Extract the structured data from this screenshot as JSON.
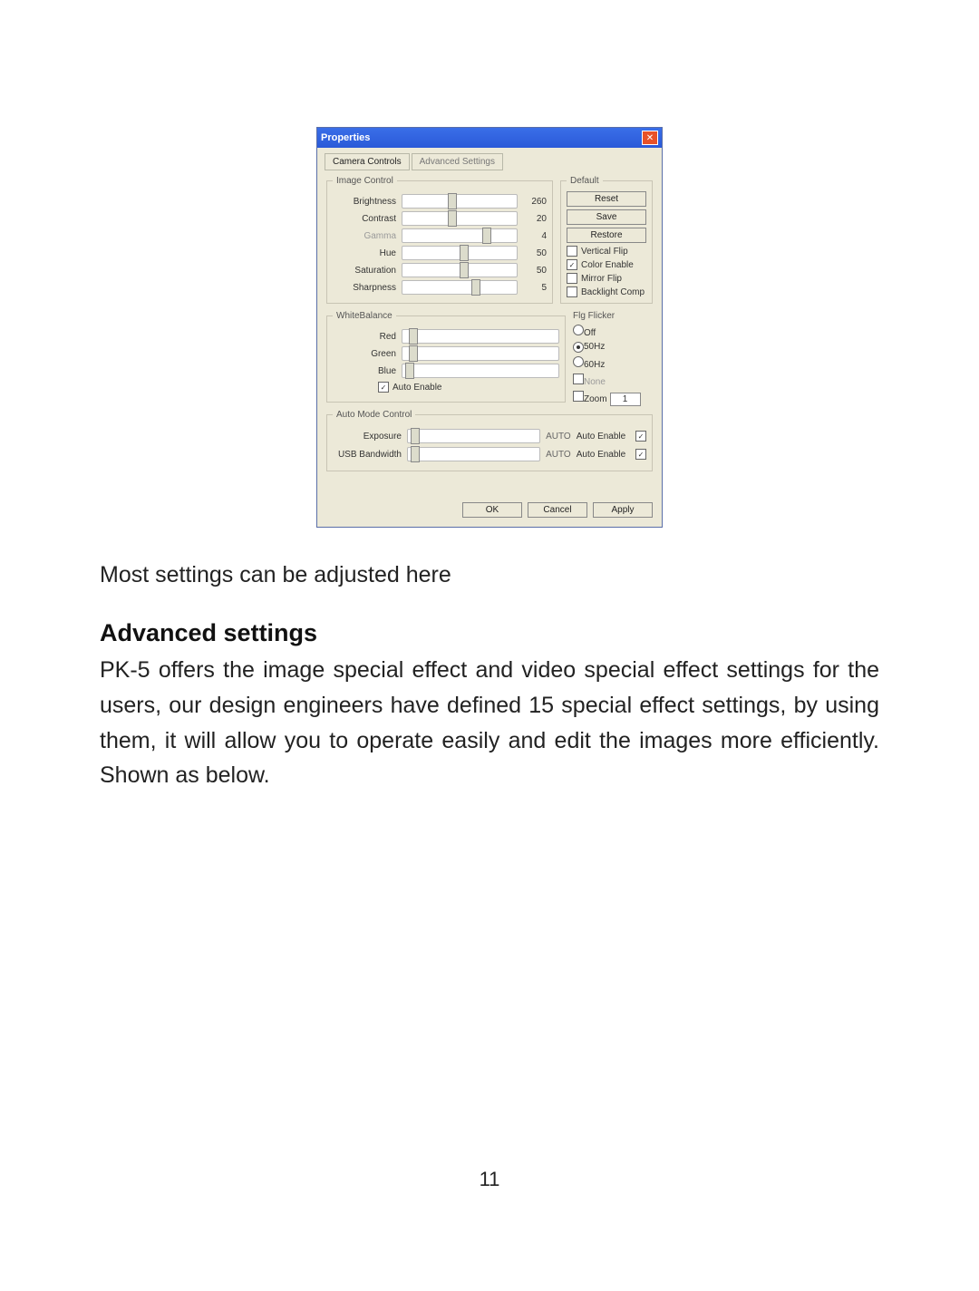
{
  "dialog": {
    "title": "Properties",
    "tabs": {
      "t0": "Camera Controls",
      "t1": "Advanced Settings"
    },
    "image_control": {
      "legend": "Image Control",
      "rows": [
        {
          "label": "Brightness",
          "value": "260",
          "pos": 40
        },
        {
          "label": "Contrast",
          "value": "20",
          "pos": 40
        },
        {
          "label": "Gamma",
          "value": "4",
          "pos": 70
        },
        {
          "label": "Hue",
          "value": "50",
          "pos": 50
        },
        {
          "label": "Saturation",
          "value": "50",
          "pos": 50
        },
        {
          "label": "Sharpness",
          "value": "5",
          "pos": 60
        }
      ]
    },
    "defaults": {
      "legend": "Default",
      "reset": "Reset",
      "save": "Save",
      "restore": "Restore",
      "vflip": "Vertical Flip",
      "color": "Color Enable",
      "mirror": "Mirror Flip",
      "back": "Backlight Comp"
    },
    "wb": {
      "legend": "WhiteBalance",
      "red": "Red",
      "green": "Green",
      "blue": "Blue",
      "auto": "Auto Enable"
    },
    "flicker": {
      "legend": "Flg Flicker",
      "off": "Off",
      "hz50": "50Hz",
      "hz60": "60Hz",
      "none": "None",
      "zoom": "Zoom",
      "zoomval": "1"
    },
    "auto": {
      "legend": "Auto Mode Control",
      "exposure": "Exposure",
      "usb": "USB Bandwidth",
      "autotxt": "AUTO",
      "en": "Auto Enable"
    },
    "btns": {
      "ok": "OK",
      "cancel": "Cancel",
      "apply": "Apply"
    }
  },
  "doc": {
    "caption": "Most settings can be adjusted here",
    "heading": "Advanced settings",
    "body": "PK-5 offers the image special effect and video special effect settings for the users, our design engineers have defined 15 special effect settings, by using them, it will allow you to operate easily and edit the images more efficiently. Shown as below.",
    "page": "11"
  }
}
